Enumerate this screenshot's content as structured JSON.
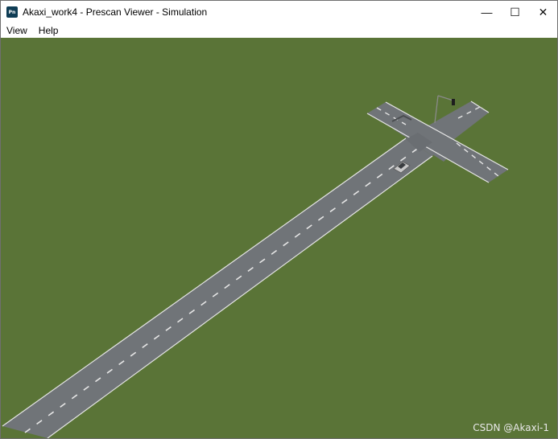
{
  "window": {
    "app_icon": "Pn",
    "title": "Akaxi_work4 - Prescan Viewer - Simulation",
    "controls": {
      "minimize": "—",
      "maximize": "☐",
      "close": "✕"
    }
  },
  "menu": {
    "view": "View",
    "help": "Help"
  },
  "scene": {
    "grass_color": "#5a7437",
    "road_color": "#707478",
    "lane_color": "#e6e6e6",
    "vehicle_color": "#c8c8c8"
  },
  "watermark": "CSDN @Akaxi-1"
}
